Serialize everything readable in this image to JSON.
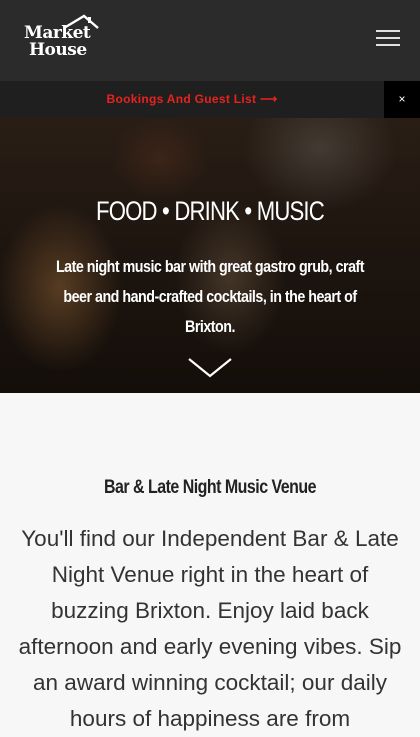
{
  "header": {
    "logo": {
      "line1": "Market",
      "line2": "House"
    }
  },
  "notice": {
    "link_label": "Bookings And Guest List ⟶",
    "close_label": "×"
  },
  "hero": {
    "heading": "FOOD • DRINK • MUSIC",
    "subheading": "Late night music bar with great gastro grub, craft beer and hand-crafted cocktails, in the heart of Brixton."
  },
  "intro": {
    "title": "Bar & Late Night Music Venue",
    "body": "You'll find our Independent Bar & Late Night Venue right in the heart of buzzing Brixton. Enjoy laid back afternoon and early evening vibes. Sip an award winning cocktail; our daily hours of happiness are from"
  },
  "colors": {
    "header_bg": "#2b2b2b",
    "notice_link": "#e8231f",
    "page_bg": "#f7f7f7"
  },
  "icons": [
    "house-roof-icon",
    "hamburger-menu-icon",
    "close-icon",
    "chevron-down-icon"
  ]
}
